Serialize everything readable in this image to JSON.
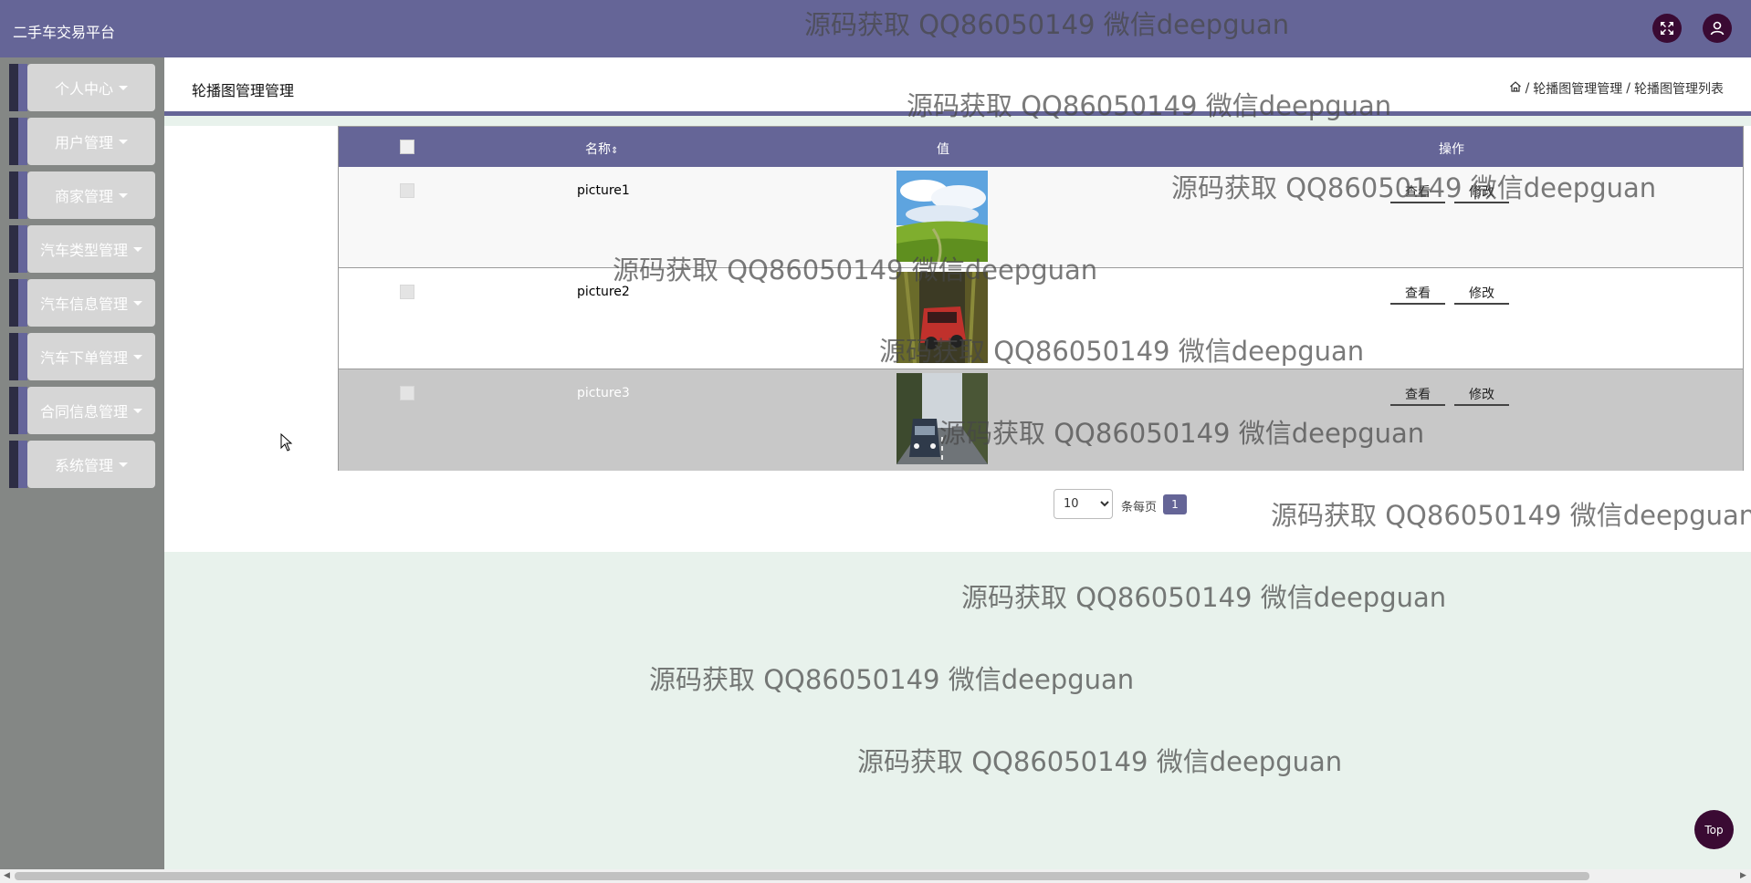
{
  "header": {
    "app_title": "二手车交易平台",
    "fullscreen_icon": "fullscreen-icon",
    "user_icon": "user-avatar-icon"
  },
  "sidebar": {
    "items": [
      {
        "label": "个人中心"
      },
      {
        "label": "用户管理"
      },
      {
        "label": "商家管理"
      },
      {
        "label": "汽车类型管理"
      },
      {
        "label": "汽车信息管理"
      },
      {
        "label": "汽车下单管理"
      },
      {
        "label": "合同信息管理"
      },
      {
        "label": "系统管理"
      }
    ]
  },
  "page": {
    "title": "轮播图管理管理",
    "breadcrumb": {
      "home_icon": "home-icon",
      "sep1": "/",
      "crumb1": "轮播图管理管理",
      "sep2": "/",
      "crumb2": "轮播图管理列表"
    }
  },
  "table": {
    "columns": {
      "name": "名称",
      "value": "值",
      "actions": "操作"
    },
    "rows": [
      {
        "name": "picture1",
        "view": "查看",
        "edit": "修改"
      },
      {
        "name": "picture2",
        "view": "查看",
        "edit": "修改"
      },
      {
        "name": "picture3",
        "view": "查看",
        "edit": "修改"
      }
    ]
  },
  "pagination": {
    "page_size": "10",
    "page_size_label": "条每页",
    "current_page": "1"
  },
  "watermark": {
    "text": "源码获取 QQ86050149 微信deepguan"
  },
  "top_button": "Top",
  "colors": {
    "primary": "#656597",
    "accent_dark": "#3a0a33",
    "sidebar_bg": "#848785",
    "content_bg": "#e8f2ec"
  }
}
